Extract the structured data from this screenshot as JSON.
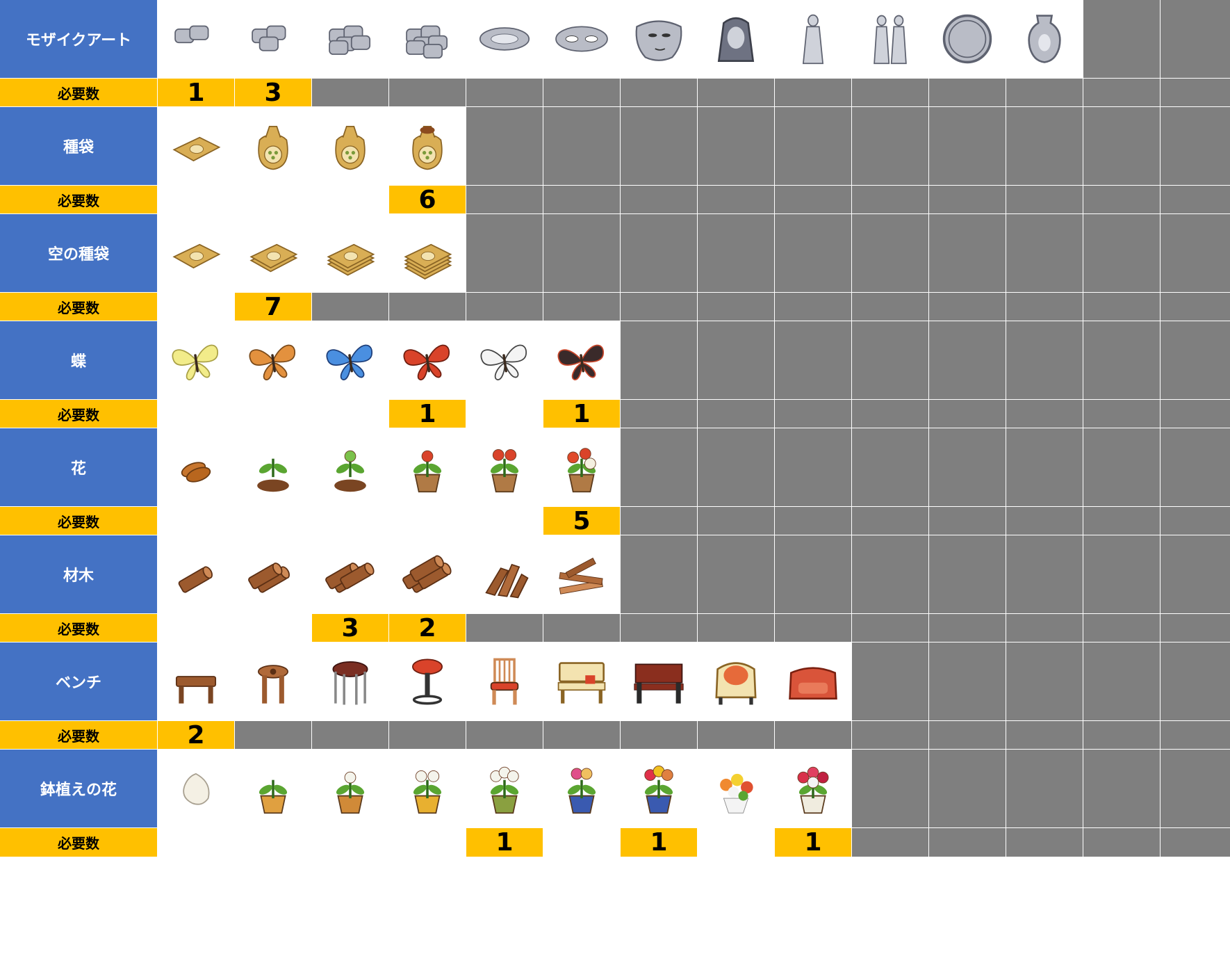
{
  "count_label": "必要数",
  "colors": {
    "label_bg": "#4472c4",
    "count_bg": "#ffc000",
    "unavailable": "#7f7f7f",
    "empty": "#ffffff"
  },
  "categories": [
    {
      "name": "モザイクアート",
      "items": [
        "mosaic-tile-1",
        "mosaic-tile-2",
        "mosaic-tiles-row",
        "mosaic-tiles-pile",
        "mosaic-eye",
        "mosaic-eyes",
        "mosaic-face",
        "mosaic-portrait",
        "mosaic-figure",
        "mosaic-couple",
        "mosaic-medallion",
        "mosaic-vase"
      ],
      "counts": [
        "1",
        "3"
      ]
    },
    {
      "name": "種袋",
      "items": [
        "seed-packet",
        "seed-sack-small",
        "seed-sack-tied",
        "seed-sack-open"
      ],
      "counts": [
        "",
        "",
        "",
        "6"
      ]
    },
    {
      "name": "空の種袋",
      "items": [
        "empty-sack-1",
        "empty-sack-2",
        "empty-sack-3",
        "empty-sack-stack"
      ],
      "counts": [
        "",
        "7"
      ]
    },
    {
      "name": "蝶",
      "items": [
        "yellow-butterfly",
        "orange-butterfly",
        "blue-butterfly",
        "red-butterfly",
        "white-butterfly",
        "admiral-butterfly"
      ],
      "counts": [
        "",
        "",
        "",
        "1",
        "",
        "1"
      ]
    },
    {
      "name": "花",
      "items": [
        "flower-seed",
        "sprout-soil",
        "sprout-bud",
        "sprout-pot",
        "tulip-pot",
        "flower-planter"
      ],
      "counts": [
        "",
        "",
        "",
        "",
        "",
        "5"
      ]
    },
    {
      "name": "材木",
      "items": [
        "log",
        "two-logs",
        "three-logs",
        "tied-logs",
        "split-wood",
        "wood-pile"
      ],
      "counts": [
        "",
        "",
        "3",
        "2"
      ]
    },
    {
      "name": "ベンチ",
      "items": [
        "wood-stool",
        "round-stool",
        "bar-stool",
        "red-bar-stool",
        "wood-chair",
        "wood-bench",
        "park-bench",
        "armchair",
        "red-sofa"
      ],
      "counts": [
        "2"
      ]
    },
    {
      "name": "鉢植えの花",
      "items": [
        "white-seed",
        "potted-sprout",
        "potted-bud",
        "potted-white-flower",
        "potted-white-flowers",
        "potted-hyacinth",
        "potted-tulips",
        "flower-bouquet",
        "potted-red-flowers"
      ],
      "counts": [
        "",
        "",
        "",
        "",
        "1",
        "",
        "1",
        "",
        "1"
      ]
    }
  ]
}
